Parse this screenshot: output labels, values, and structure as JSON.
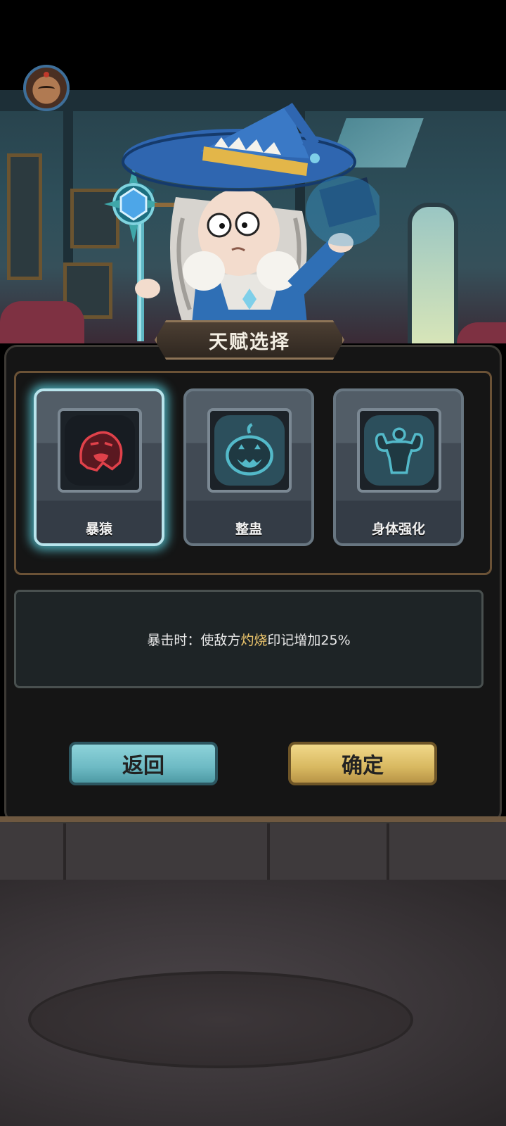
{
  "title": "天赋选择",
  "talents": [
    {
      "label": "暴猿",
      "icon": "gorilla-icon",
      "selected": true,
      "icon_color": "#e0414a"
    },
    {
      "label": "整蛊",
      "icon": "pumpkin-icon",
      "selected": false,
      "icon_color": "#53b9c9"
    },
    {
      "label": "身体强化",
      "icon": "muscle-icon",
      "selected": false,
      "icon_color": "#53b9c9"
    }
  ],
  "description": {
    "prefix": "暴击时：使敌方",
    "highlight": "灼烧",
    "suffix": "印记增加25%",
    "highlight_color": "#f1c96e"
  },
  "buttons": {
    "back": "返回",
    "confirm": "确定"
  },
  "colors": {
    "back_button": "#6dbac4",
    "confirm_button": "#d8b860",
    "selected_glow": "#58cddc"
  }
}
